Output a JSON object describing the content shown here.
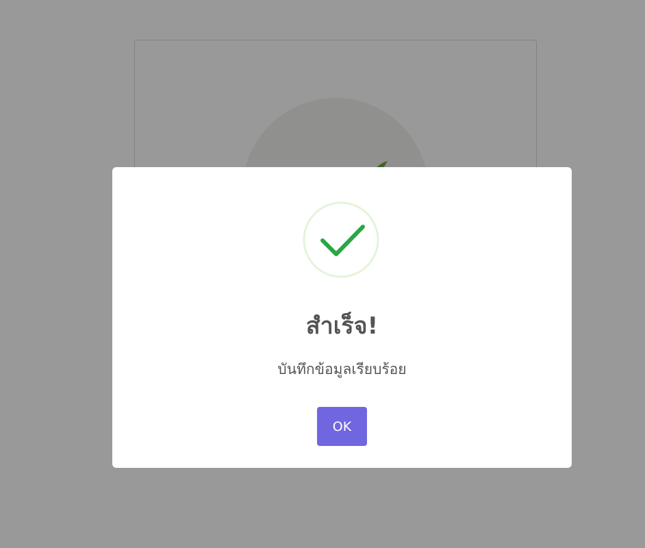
{
  "background": {
    "card": {
      "icon": "leaf-check-icon"
    }
  },
  "dialog": {
    "icon": "check-circle-icon",
    "title": "สำเร็จ!",
    "message": "บันทึกข้อมูลเรียบร้อย",
    "confirm_label": "OK"
  },
  "colors": {
    "accent": "#7066e0",
    "success": "#28a745",
    "success_ring": "#e4f4d9",
    "text": "#545454",
    "overlay": "rgba(0,0,0,0.4)"
  }
}
